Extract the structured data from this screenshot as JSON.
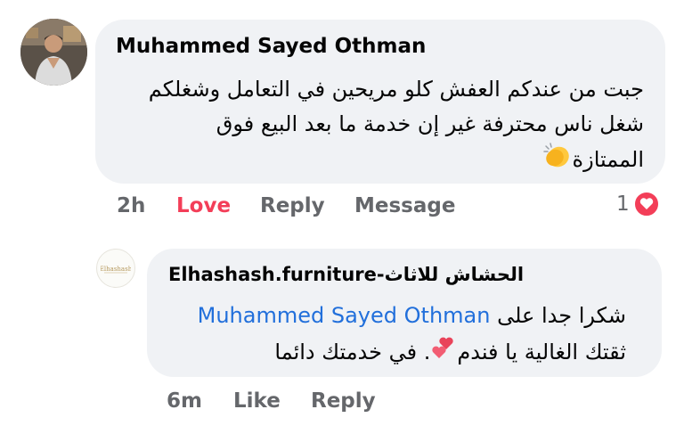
{
  "comment": {
    "author": "Muhammed Sayed Othman",
    "lines": [
      "جبت من عندكم العفش كلو مريحين في التعامل وشغلكم",
      "شغل ناس محترفة غير إن خدمة ما بعد البيع فوق",
      "الممتازة"
    ],
    "actions": {
      "time": "2h",
      "love": "Love",
      "reply": "Reply",
      "message": "Message"
    },
    "reaction_count": "1",
    "reaction_icon": "heart-icon",
    "emoji": "clapping-hands-icon"
  },
  "reply": {
    "author": "Elhashash.furniture-الحشاش للاثاث",
    "line1_prefix": "شكرا جدا على",
    "mention": "Muhammed Sayed Othman",
    "line2_before_emoji": "ثقتك الغالية يا فندم",
    "line2_after_emoji": ". في خدمتك دائما",
    "emoji": "two-hearts-icon",
    "avatar_logo": "hashash-logo",
    "actions": {
      "time": "6m",
      "like": "Like",
      "reply": "Reply"
    }
  },
  "colors": {
    "bubble": "#f0f2f5",
    "love": "#f33e58",
    "mention": "#216fdb",
    "secondary_text": "#65676b"
  }
}
